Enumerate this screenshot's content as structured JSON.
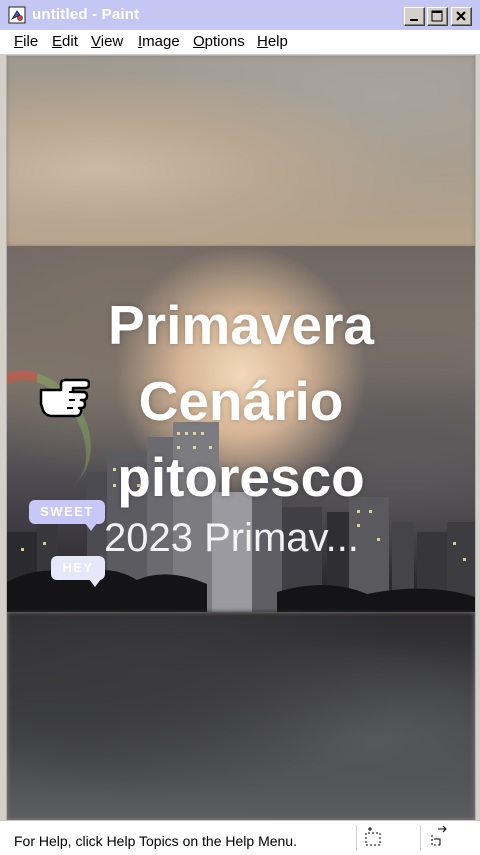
{
  "window": {
    "title": "untitled - Paint",
    "icon": "paint-app-icon",
    "controls": [
      "minimize-icon",
      "maximize-icon",
      "close-icon"
    ]
  },
  "menu": [
    {
      "label": "File",
      "key": "F",
      "rest": "ile"
    },
    {
      "label": "Edit",
      "key": "E",
      "rest": "dit"
    },
    {
      "label": "View",
      "key": "V",
      "rest": "iew"
    },
    {
      "label": "Image",
      "key": "I",
      "rest": "mage"
    },
    {
      "label": "Options",
      "key": "O",
      "rest": "ptions"
    },
    {
      "label": "Help",
      "key": "H",
      "rest": "elp"
    }
  ],
  "canvas": {
    "headline_lines": [
      "Primavera",
      "Cenário",
      "pitoresco"
    ],
    "subtitle": "2023 Primav...",
    "stickers": [
      "SWEET",
      "HEY"
    ],
    "cursor_icon": "pointing-hand-icon"
  },
  "status": {
    "text": "For Help, click Help Topics on the Help Menu.",
    "icons": [
      "selection-size-icon",
      "canvas-resize-icon"
    ]
  }
}
